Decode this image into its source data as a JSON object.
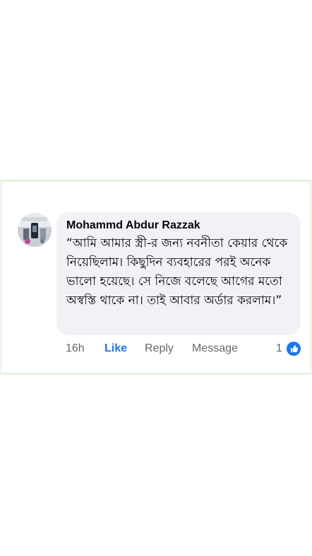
{
  "comment": {
    "author": "Mohammd Abdur Razzak",
    "text": "“আমি আমার স্ত্রী-র জন্য নবনীতা কেয়ার থেকে নিয়েছিলাম। কিছুদিন ব্যবহারের পরই অনেক ভালো হয়েছে। সে নিজে বলেছে আগের মতো অস্বস্তি থাকে না। তাই আবার অর্ডার করলাম।”",
    "timestamp": "16h",
    "reaction_count": "1"
  },
  "actions": {
    "like": "Like",
    "reply": "Reply",
    "message": "Message"
  },
  "icons": {
    "avatar": "profile-avatar",
    "reaction": "like-icon"
  },
  "colors": {
    "like_blue": "#1877f2",
    "bubble": "#f0f2f5",
    "meta_text": "#65676b"
  }
}
